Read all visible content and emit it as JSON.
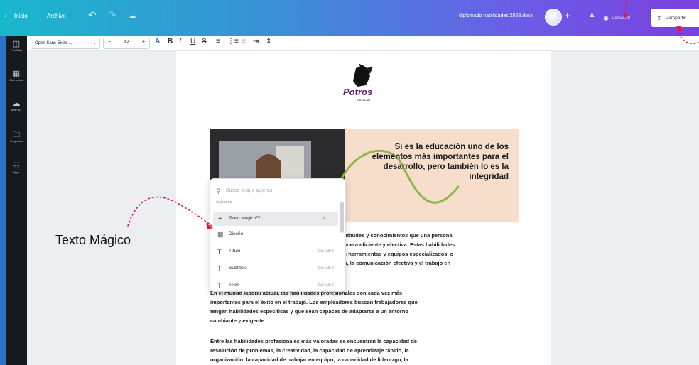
{
  "topbar": {
    "home_label": "Inicio",
    "file_label": "Archivo",
    "doc_title": "diplomado habilidades 2023.docx",
    "convert_label": "Convertir",
    "share_label": "Compartir"
  },
  "sidebar": {
    "items": [
      {
        "label": "Plantillas",
        "icon": "layout-icon"
      },
      {
        "label": "Elementos",
        "icon": "shapes-icon"
      },
      {
        "label": "Subir ar...",
        "icon": "upload-icon"
      },
      {
        "label": "Proyectos",
        "icon": "folder-icon"
      },
      {
        "label": "Apps",
        "icon": "apps-icon"
      }
    ]
  },
  "toolbar": {
    "font_name": "Open Sans Extra ...",
    "font_size": "12"
  },
  "document": {
    "logo_text": "Potros",
    "logo_sub": "CATALAN",
    "banner_text": "Si es la educación uno de los elementos más importantes para el desarrollo, pero también lo es la integridad",
    "para1_fragment_lines": [
      "ptitudes y conocimientos que una persona",
      "anera eficiente y efectiva. Estas habilidades",
      "e herramientas y equipos especializados, o",
      "o, la comunicación efectiva y el trabajo en"
    ],
    "para2_lines": [
      "En el mundo laboral actual, las habilidades profesionales son cada vez más",
      "importantes para el éxito en el trabajo. Los empleadores buscan trabajadores que",
      "tengan habilidades específicas y que sean capaces de adaptarse a un entorno",
      "cambiante y exigente."
    ],
    "para3_lines": [
      "Entre las habilidades profesionales más valoradas se encuentran la capacidad de",
      "resolución de problemas, la creatividad, la capacidad de aprendizaje rápido, la",
      "organización, la capacidad de trabajar en equipo, la capacidad de liderazgo, la"
    ]
  },
  "popup": {
    "search_placeholder": "Busca lo que quieras",
    "section_label": "Acciones",
    "items": [
      {
        "label": "Texto Mágico™",
        "shortcut": "",
        "icon": "magic-wand-icon"
      },
      {
        "label": "Diseño",
        "shortcut": "",
        "icon": "design-icon"
      },
      {
        "label": "Título",
        "shortcut": "Ctrl+Alt+1",
        "icon": "heading-icon"
      },
      {
        "label": "Subtítulo",
        "shortcut": "Ctrl+Alt+2",
        "icon": "subheading-icon"
      },
      {
        "label": "Texto",
        "shortcut": "Ctrl+Alt+0",
        "icon": "text-icon"
      }
    ]
  },
  "annotation": {
    "label": "Texto Mágico"
  }
}
